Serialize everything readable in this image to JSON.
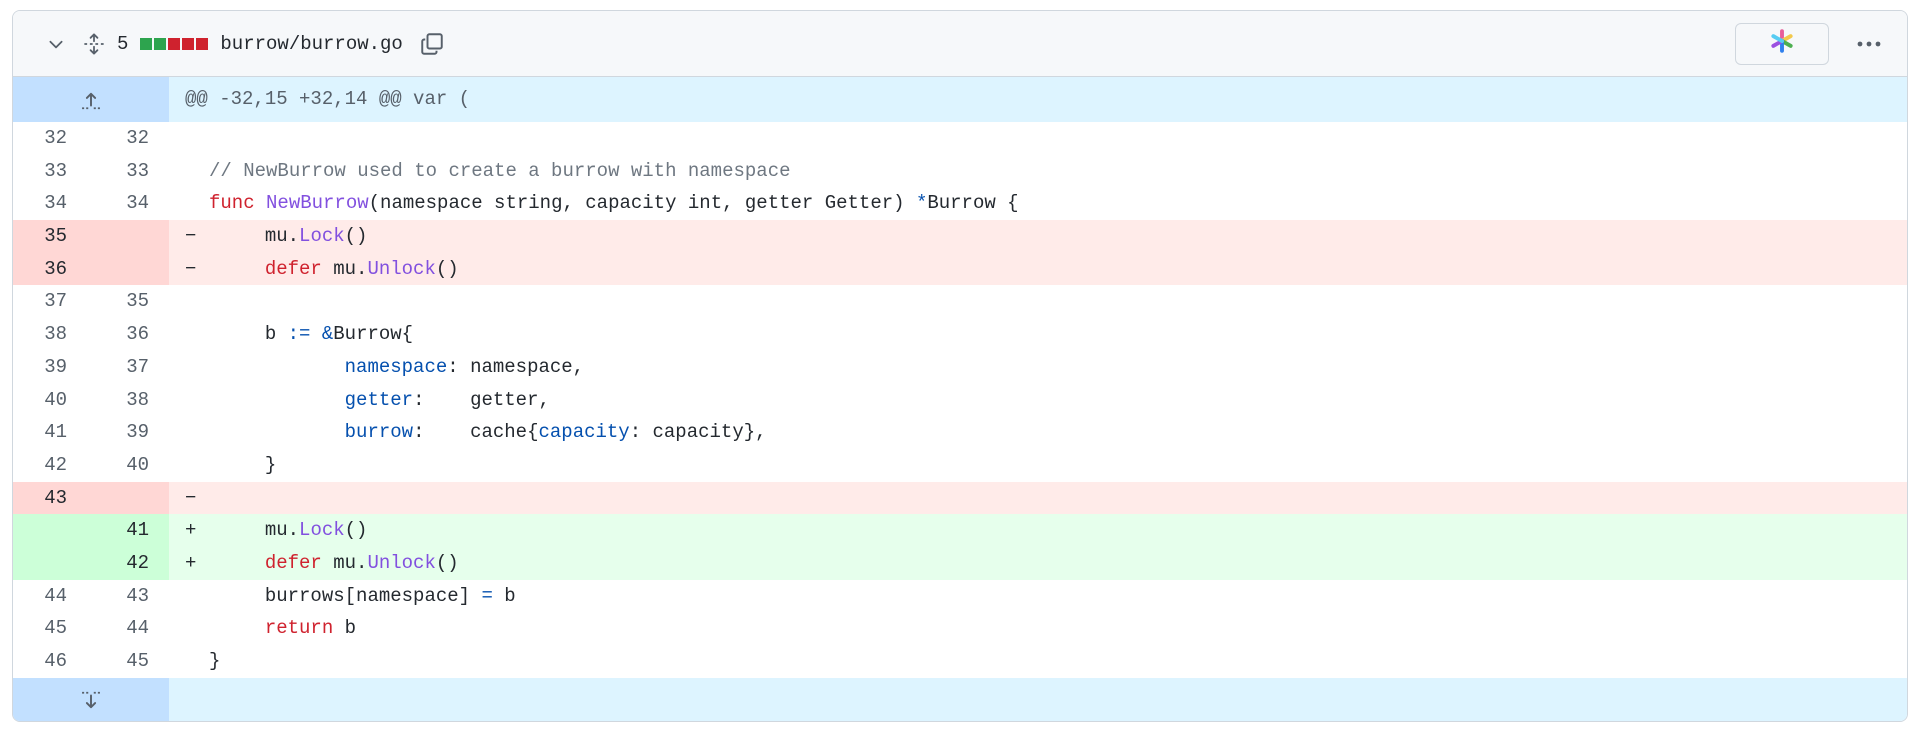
{
  "file": {
    "changes_count": "5",
    "path": "burrow/burrow.go",
    "diffstat": [
      "add",
      "add",
      "del",
      "del",
      "del"
    ],
    "colors": {
      "add": "#2da44e",
      "del": "#cf222e"
    }
  },
  "icons": {
    "collapse": "chevron-down-icon",
    "expand_all": "unfold-icon",
    "copy": "copy-icon",
    "copilot": "sparkle-icon",
    "more": "kebab-horizontal-icon",
    "expand_up": "fold-up-icon",
    "expand_down": "fold-down-icon"
  },
  "hunk_header": "@@ -32,15 +32,14 @@ var (",
  "lines": [
    {
      "type": "ctx",
      "old": "32",
      "new": "32",
      "marker": " ",
      "tokens": []
    },
    {
      "type": "ctx",
      "old": "33",
      "new": "33",
      "marker": " ",
      "tokens": [
        [
          "cm",
          "// NewBurrow used to create a burrow with namespace"
        ]
      ]
    },
    {
      "type": "ctx",
      "old": "34",
      "new": "34",
      "marker": " ",
      "tokens": [
        [
          "kw",
          "func"
        ],
        [
          "",
          " "
        ],
        [
          "fn",
          "NewBurrow"
        ],
        [
          "",
          "(namespace string, capacity int, getter Getter) "
        ],
        [
          "op",
          "*"
        ],
        [
          "",
          "Burrow {"
        ]
      ]
    },
    {
      "type": "del",
      "old": "35",
      "new": "",
      "marker": "−",
      "tokens": [
        [
          "",
          "\tmu."
        ],
        [
          "fn",
          "Lock"
        ],
        [
          "",
          "()"
        ]
      ]
    },
    {
      "type": "del",
      "old": "36",
      "new": "",
      "marker": "−",
      "tokens": [
        [
          "",
          "\t"
        ],
        [
          "kw",
          "defer"
        ],
        [
          "",
          " mu."
        ],
        [
          "fn",
          "Unlock"
        ],
        [
          "",
          "()"
        ]
      ]
    },
    {
      "type": "ctx",
      "old": "37",
      "new": "35",
      "marker": " ",
      "tokens": []
    },
    {
      "type": "ctx",
      "old": "38",
      "new": "36",
      "marker": " ",
      "tokens": [
        [
          "",
          "\tb "
        ],
        [
          "op",
          ":="
        ],
        [
          "",
          " "
        ],
        [
          "op",
          "&"
        ],
        [
          "",
          "Burrow{"
        ]
      ]
    },
    {
      "type": "ctx",
      "old": "39",
      "new": "37",
      "marker": " ",
      "tokens": [
        [
          "",
          "\t\t"
        ],
        [
          "fld",
          "namespace"
        ],
        [
          "",
          ": namespace,"
        ]
      ]
    },
    {
      "type": "ctx",
      "old": "40",
      "new": "38",
      "marker": " ",
      "tokens": [
        [
          "",
          "\t\t"
        ],
        [
          "fld",
          "getter"
        ],
        [
          "",
          ":    getter,"
        ]
      ]
    },
    {
      "type": "ctx",
      "old": "41",
      "new": "39",
      "marker": " ",
      "tokens": [
        [
          "",
          "\t\t"
        ],
        [
          "fld",
          "burrow"
        ],
        [
          "",
          ":    cache{"
        ],
        [
          "fld",
          "capacity"
        ],
        [
          "",
          ": capacity},"
        ]
      ]
    },
    {
      "type": "ctx",
      "old": "42",
      "new": "40",
      "marker": " ",
      "tokens": [
        [
          "",
          "\t}"
        ]
      ]
    },
    {
      "type": "del",
      "old": "43",
      "new": "",
      "marker": "−",
      "tokens": []
    },
    {
      "type": "add",
      "old": "",
      "new": "41",
      "marker": "+",
      "tokens": [
        [
          "",
          "\tmu."
        ],
        [
          "fn",
          "Lock"
        ],
        [
          "",
          "()"
        ]
      ]
    },
    {
      "type": "add",
      "old": "",
      "new": "42",
      "marker": "+",
      "tokens": [
        [
          "",
          "\t"
        ],
        [
          "kw",
          "defer"
        ],
        [
          "",
          " mu."
        ],
        [
          "fn",
          "Unlock"
        ],
        [
          "",
          "()"
        ]
      ]
    },
    {
      "type": "ctx",
      "old": "44",
      "new": "43",
      "marker": " ",
      "tokens": [
        [
          "",
          "\tburrows[namespace] "
        ],
        [
          "op",
          "="
        ],
        [
          "",
          " b"
        ]
      ]
    },
    {
      "type": "ctx",
      "old": "45",
      "new": "44",
      "marker": " ",
      "tokens": [
        [
          "",
          "\t"
        ],
        [
          "kw",
          "return"
        ],
        [
          "",
          " b"
        ]
      ]
    },
    {
      "type": "ctx",
      "old": "46",
      "new": "45",
      "marker": " ",
      "tokens": [
        [
          "",
          "}"
        ]
      ]
    }
  ]
}
